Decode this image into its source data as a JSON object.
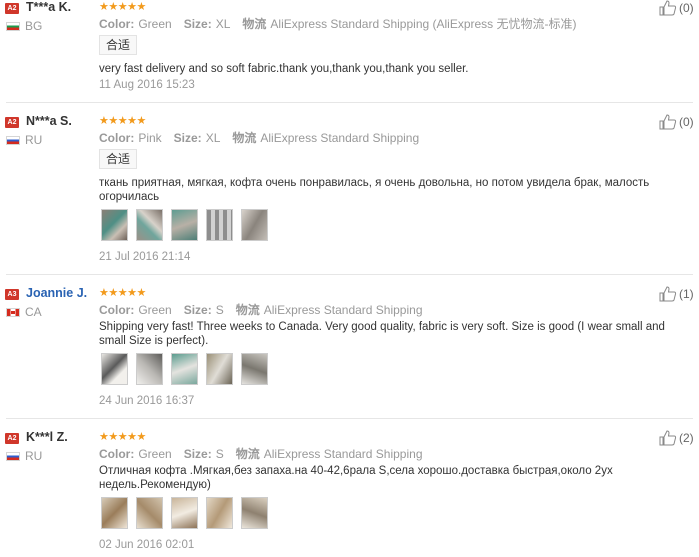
{
  "labels": {
    "color": "Color:",
    "size": "Size:",
    "shipping": "物流"
  },
  "colors": {
    "accent_star": "#f29a1c",
    "level_badge": "#d0372b",
    "link": "#2a63b3",
    "muted": "#999999"
  },
  "reviews": [
    {
      "level": "A2",
      "name": "T***a K.",
      "country": "BG",
      "flag": "bg",
      "stars": "★★★★★",
      "rating": 5,
      "color": "Green",
      "size": "XL",
      "shipping": "AliExpress Standard Shipping (AliExpress 无忧物流-标准)",
      "tag": "合适",
      "text": "very fast delivery and so soft fabric.thank you,thank you,thank you seller.",
      "date": "11 Aug 2016 15:23",
      "helpful": "(0)",
      "photos": []
    },
    {
      "level": "A2",
      "name": "N***a S.",
      "country": "RU",
      "flag": "ru",
      "stars": "★★★★★",
      "rating": 5,
      "color": "Pink",
      "size": "XL",
      "shipping": "AliExpress Standard Shipping",
      "tag": "合适",
      "text": "ткань приятная, мягкая, кофта очень понравилась, я очень довольна, но потом увидела брак, малость огорчилась",
      "date": "21 Jul 2016 21:14",
      "helpful": "(0)",
      "photos": [
        "photo-1",
        "photo-2",
        "photo-3",
        "photo-4",
        "photo-5"
      ]
    },
    {
      "level": "A3",
      "name": "Joannie J.",
      "country": "CA",
      "flag": "ca",
      "stars": "★★★★★",
      "rating": 5,
      "color": "Green",
      "size": "S",
      "shipping": "AliExpress Standard Shipping",
      "tag": "",
      "text": "Shipping very fast! Three weeks to Canada. Very good quality, fabric is very soft. Size is good (I wear small and small Size is perfect).",
      "date": "24 Jun 2016 16:37",
      "helpful": "(1)",
      "photos": [
        "photo-1",
        "photo-2",
        "photo-3",
        "photo-4",
        "photo-5"
      ]
    },
    {
      "level": "A2",
      "name": "K***l Z.",
      "country": "RU",
      "flag": "ru",
      "stars": "★★★★★",
      "rating": 5,
      "color": "Green",
      "size": "S",
      "shipping": "AliExpress Standard Shipping",
      "tag": "",
      "text": "Отличная кофта .Мягкая,без запаха.на 40-42,6рала S,села хорошо.доставка быстрая,около 2ух недель.Рекомендую)",
      "date": "02 Jun 2016 02:01",
      "helpful": "(2)",
      "photos": [
        "photo-1",
        "photo-2",
        "photo-3",
        "photo-4",
        "photo-5"
      ]
    }
  ]
}
